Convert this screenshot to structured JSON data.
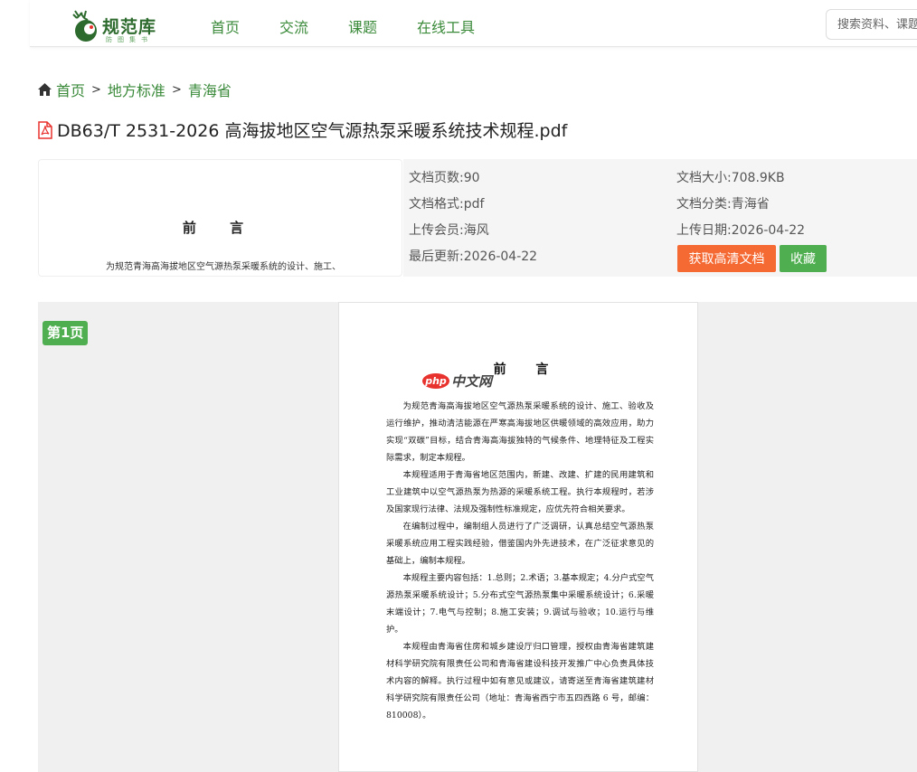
{
  "header": {
    "logo_text": "规范库",
    "logo_sub": "防图集书",
    "nav": [
      "首页",
      "交流",
      "课题",
      "在线工具"
    ],
    "search_placeholder": "搜索资料、课题"
  },
  "breadcrumb": [
    "首页",
    "地方标准",
    "青海省"
  ],
  "doc_title": "DB63/T 2531-2026 高海拔地区空气源热泵采暖系统技术规程.pdf",
  "thumb": {
    "title": "前 言",
    "line": "为规范青海高海拔地区空气源热泵采暖系统的设计、施工、"
  },
  "meta": {
    "pages_label": "文档页数:",
    "pages": "90",
    "size_label": "文档大小:",
    "size": "708.9KB",
    "format_label": "文档格式:",
    "format": "pdf",
    "category_label": "文档分类:",
    "category": "青海省",
    "uploader_label": "上传会员:",
    "uploader": "海风",
    "upload_date_label": "上传日期:",
    "upload_date": "2026-04-22",
    "updated_label": "最后更新:",
    "updated": "2026-04-22",
    "btn_get": "获取高清文档",
    "btn_fav": "收藏"
  },
  "viewer": {
    "page_badge": "第1页",
    "heading": "前 言",
    "watermark_php": "php",
    "watermark_cn": "中文网",
    "paragraphs": [
      "为规范青海高海拔地区空气源热泵采暖系统的设计、施工、验收及运行维护，推动清洁能源在严寒高海拔地区供暖领域的高效应用，助力实现“双碳”目标，结合青海高海拔独特的气候条件、地理特征及工程实际需求，制定本规程。",
      "本规程适用于青海省地区范围内，新建、改建、扩建的民用建筑和工业建筑中以空气源热泵为热源的采暖系统工程。执行本规程时，若涉及国家现行法律、法规及强制性标准规定，应优先符合相关要求。",
      "在编制过程中，编制组人员进行了广泛调研，认真总结空气源热泵采暖系统应用工程实践经验，借鉴国内外先进技术，在广泛征求意见的基础上，编制本规程。",
      "本规程主要内容包括：1.总则；2.术语；3.基本规定；4.分户式空气源热泵采暖系统设计；5.分布式空气源热泵集中采暖系统设计；6.采暖末端设计；7.电气与控制；8.施工安装；9.调试与验收；10.运行与维护。",
      "本规程由青海省住房和城乡建设厅归口管理，授权由青海省建筑建材科学研究院有限责任公司和青海省建设科技开发推广中心负责具体技术内容的解释。执行过程中如有意见或建议，请寄送至青海省建筑建材科学研究院有限责任公司（地址：青海省西宁市五四西路 6 号，邮编：810008）。"
    ]
  }
}
